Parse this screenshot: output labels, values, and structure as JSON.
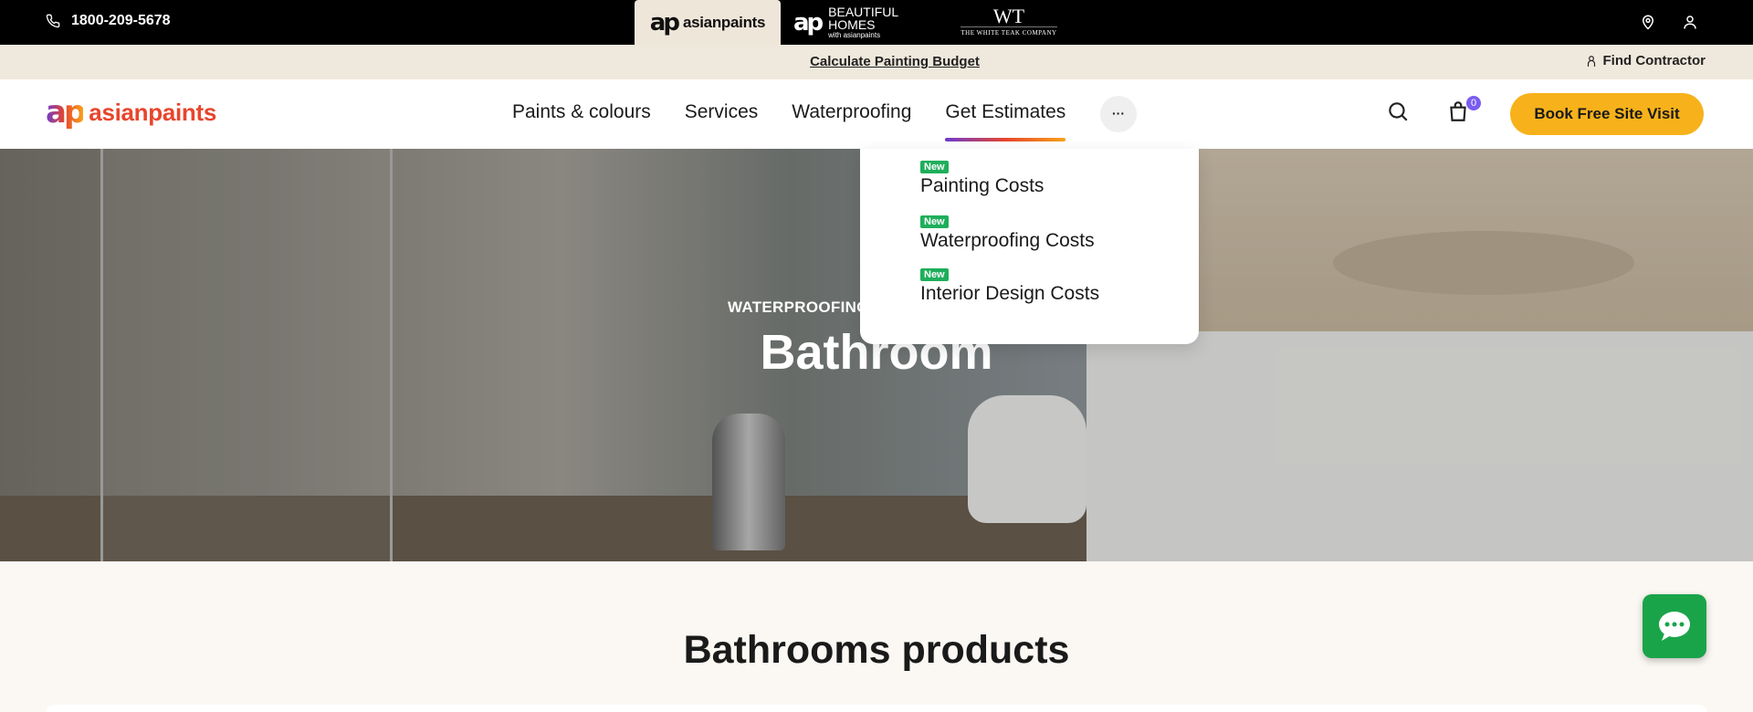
{
  "topbar": {
    "phone": "1800-209-5678",
    "brands": [
      {
        "name": "asianpaints"
      },
      {
        "name": "BEAUTIFUL HOMES",
        "sub": "with asianpaints"
      },
      {
        "name": "WT",
        "sub": "THE WHITE TEAK COMPANY"
      }
    ],
    "icons": [
      "location-icon",
      "user-icon"
    ]
  },
  "strip": {
    "budget_link": "Calculate Painting Budget",
    "contractor_link": "Find Contractor"
  },
  "nav": {
    "logo_text": "asianpaints",
    "menu": [
      "Paints & colours",
      "Services",
      "Waterproofing",
      "Get Estimates"
    ],
    "more": "···",
    "cart_count": "0",
    "cta": "Book Free Site Visit"
  },
  "dropdown": {
    "items": [
      {
        "badge": "New",
        "label": "Painting Costs"
      },
      {
        "badge": "New",
        "label": "Waterproofing Costs"
      },
      {
        "badge": "New",
        "label": "Interior Design Costs"
      }
    ]
  },
  "hero": {
    "kicker": "WATERPROOFING",
    "title": "Bathroom"
  },
  "section": {
    "title": "Bathrooms products"
  },
  "colors": {
    "accent": "#f7b21b",
    "brand": "#e8452c",
    "badge_green": "#1fae5b",
    "chat_green": "#1aa44a"
  }
}
